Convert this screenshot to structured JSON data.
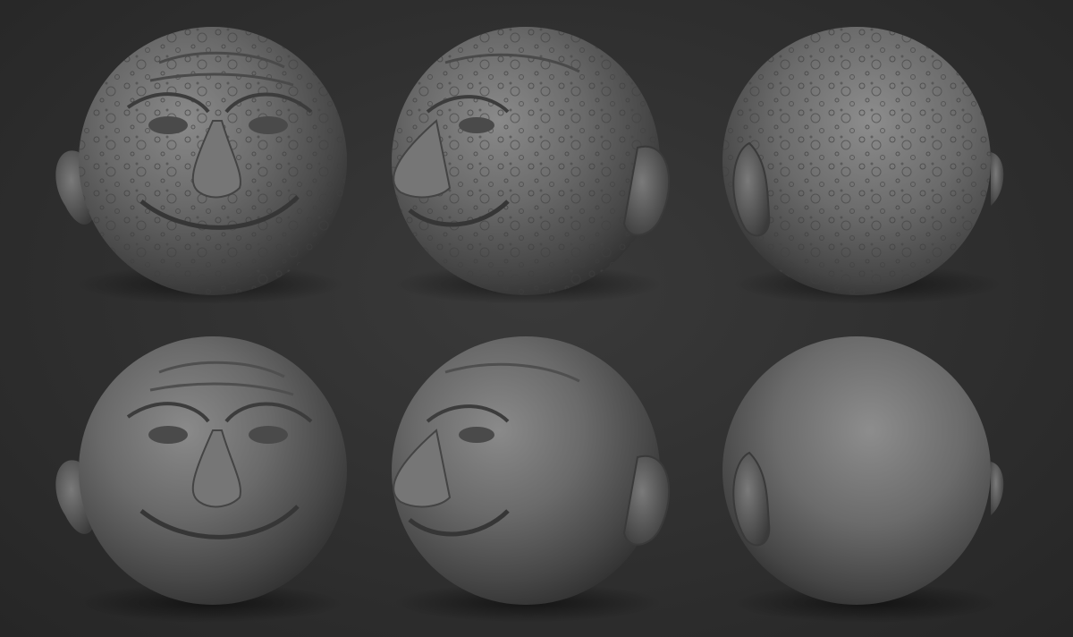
{
  "render": {
    "background_color": "#2f2f2f",
    "clay_color": "#6b6b6b"
  },
  "rows": [
    {
      "surface": "cratered",
      "views": [
        {
          "view": "front",
          "icon": "sculpt-head-front"
        },
        {
          "view": "three-quarter",
          "icon": "sculpt-head-three-quarter"
        },
        {
          "view": "back",
          "icon": "sculpt-head-back"
        }
      ]
    },
    {
      "surface": "smooth",
      "views": [
        {
          "view": "front",
          "icon": "sculpt-head-front"
        },
        {
          "view": "three-quarter",
          "icon": "sculpt-head-three-quarter"
        },
        {
          "view": "back",
          "icon": "sculpt-head-back"
        }
      ]
    }
  ]
}
